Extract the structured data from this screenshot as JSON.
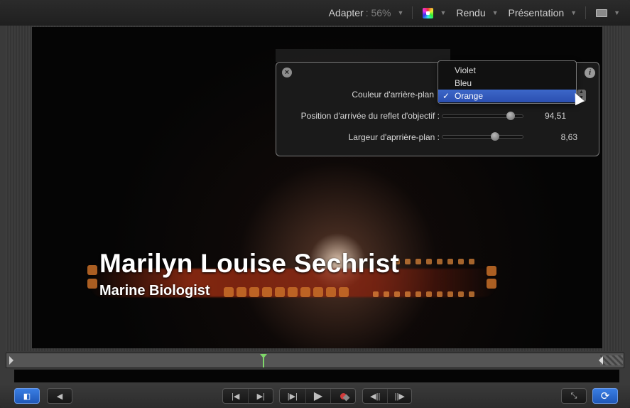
{
  "toolbar": {
    "zoom_label": "Adapter",
    "zoom_value": ": 56%",
    "color_channel_icon": "color-channels-icon",
    "render_label": "Rendu",
    "view_label": "Présentation",
    "layout_icon": "view-layout-icon"
  },
  "canvas": {
    "title_main": "Marilyn Louise Sechrist",
    "title_sub": "Marine Biologist"
  },
  "hud": {
    "close_icon": "close-icon",
    "info_icon": "info-icon",
    "bg_color_label": "Couleur d'arrière-plan",
    "flare_position_label": "Position d'arrivée du reflet d'objectif :",
    "flare_position_value": "94,51",
    "flare_position_fraction": 0.87,
    "bg_width_label": "Largeur d'aprrière-plan :",
    "bg_width_value": "8,63",
    "bg_width_fraction": 0.66
  },
  "dropdown": {
    "options": [
      "Violet",
      "Bleu",
      "Orange"
    ],
    "selected": "Orange",
    "check": "✓"
  },
  "timeline": {
    "playhead_position": 0.41
  },
  "bottombar": {
    "glyphs": {
      "sidebar": "◧",
      "audio": "◀",
      "go_start": "|◀",
      "go_end": "▶|",
      "play_from_start": "|▶|",
      "play": "▶",
      "prev_frame": "◀||",
      "next_frame": "||▶",
      "fullscreen": "⤡",
      "loop": "⟳"
    }
  },
  "colors": {
    "accent_blue": "#3a7ee4",
    "selection_blue": "#2f55b8",
    "playhead_green": "#7fd86a",
    "record_red": "#d23a3a"
  }
}
